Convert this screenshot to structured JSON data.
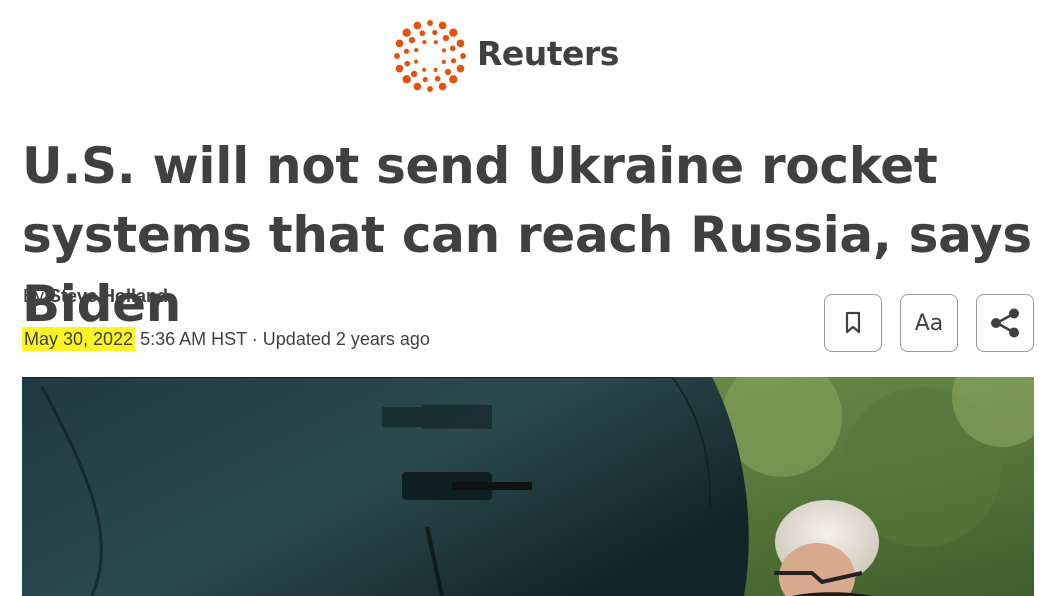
{
  "brand": {
    "name": "Reuters",
    "logo_icon": "reuters-dotted-circle-logo",
    "accent": "#e3530f"
  },
  "article": {
    "headline": "U.S. will not send Ukraine rocket systems that can reach Russia, says Biden",
    "byline_prefix": "By ",
    "author": "Steve Holland",
    "date": "May 30, 2022",
    "time_rest": " 5:36 AM HST · Updated 2 years ago"
  },
  "toolbar": [
    {
      "name": "bookmark",
      "icon": "bookmark-icon"
    },
    {
      "name": "text-size",
      "icon": "text-size-icon",
      "label": "Aa"
    },
    {
      "name": "share",
      "icon": "share-icon"
    }
  ],
  "highlight_color": "#fbf325"
}
